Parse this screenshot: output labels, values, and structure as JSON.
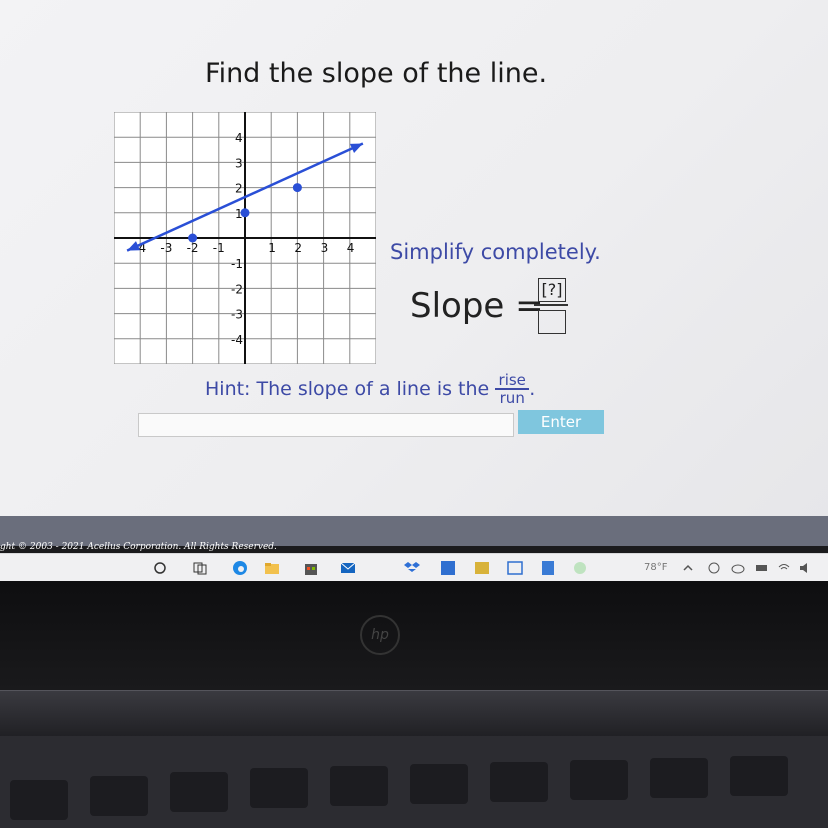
{
  "question": {
    "title": "Find the slope of the line.",
    "simplify": "Simplify completely.",
    "slope_label": "Slope =",
    "numerator": "[?]",
    "hint_text": "Hint: The slope of a line is the",
    "hint_numerator": "rise",
    "hint_denominator": "run",
    "hint_end": "."
  },
  "answer": {
    "value": "",
    "enter_label": "Enter"
  },
  "footer": {
    "copyright": "ght © 2003 - 2021 Acellus Corporation.  All Rights Reserved."
  },
  "taskbar": {
    "temperature": "78°F"
  },
  "chart_data": {
    "type": "line",
    "x_ticks": [
      "-4",
      "-3",
      "-2",
      "-1",
      "1",
      "2",
      "3",
      "4"
    ],
    "y_ticks": [
      "4",
      "3",
      "2",
      "1",
      "-1",
      "-2",
      "-3",
      "-4"
    ],
    "xlim": [
      -5,
      5
    ],
    "ylim": [
      -5,
      5
    ],
    "grid": true,
    "line": {
      "x": [
        -4.5,
        4.5
      ],
      "y": [
        -0.5,
        3.75
      ]
    },
    "points": [
      {
        "x": -2,
        "y": 0
      },
      {
        "x": 0,
        "y": 1
      },
      {
        "x": 2,
        "y": 2
      }
    ],
    "color": "#2a4fd6"
  }
}
